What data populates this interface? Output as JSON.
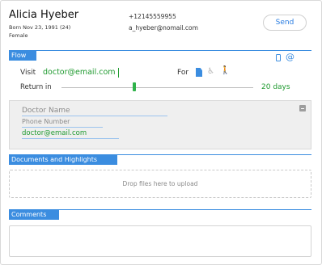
{
  "patient": {
    "name": "Alicia Hyeber",
    "born": "Born Nov 23, 1991 (24)",
    "sex": "Female",
    "phone": "+12145559955",
    "email": "a_hyeber@nomail.com"
  },
  "actions": {
    "send_label": "Send"
  },
  "flow": {
    "section_label": "Flow",
    "email_icon_glyph": "@",
    "visit_label": "Visit",
    "visit_value": "doctor@email.com",
    "for_label": "For",
    "return_label": "Return in",
    "return_value": "20 days",
    "return_fraction": 0.38
  },
  "doctor": {
    "name_placeholder": "Doctor Name",
    "phone_placeholder": "Phone Number",
    "email_value": "doctor@email.com"
  },
  "documents": {
    "section_label": "Documents and Highlights",
    "drop_text": "Drop files here to upload"
  },
  "comments": {
    "section_label": "Comments"
  },
  "colors": {
    "accent": "#3b8de0",
    "success": "#1f9a2f",
    "slider": "#2fb34a"
  }
}
